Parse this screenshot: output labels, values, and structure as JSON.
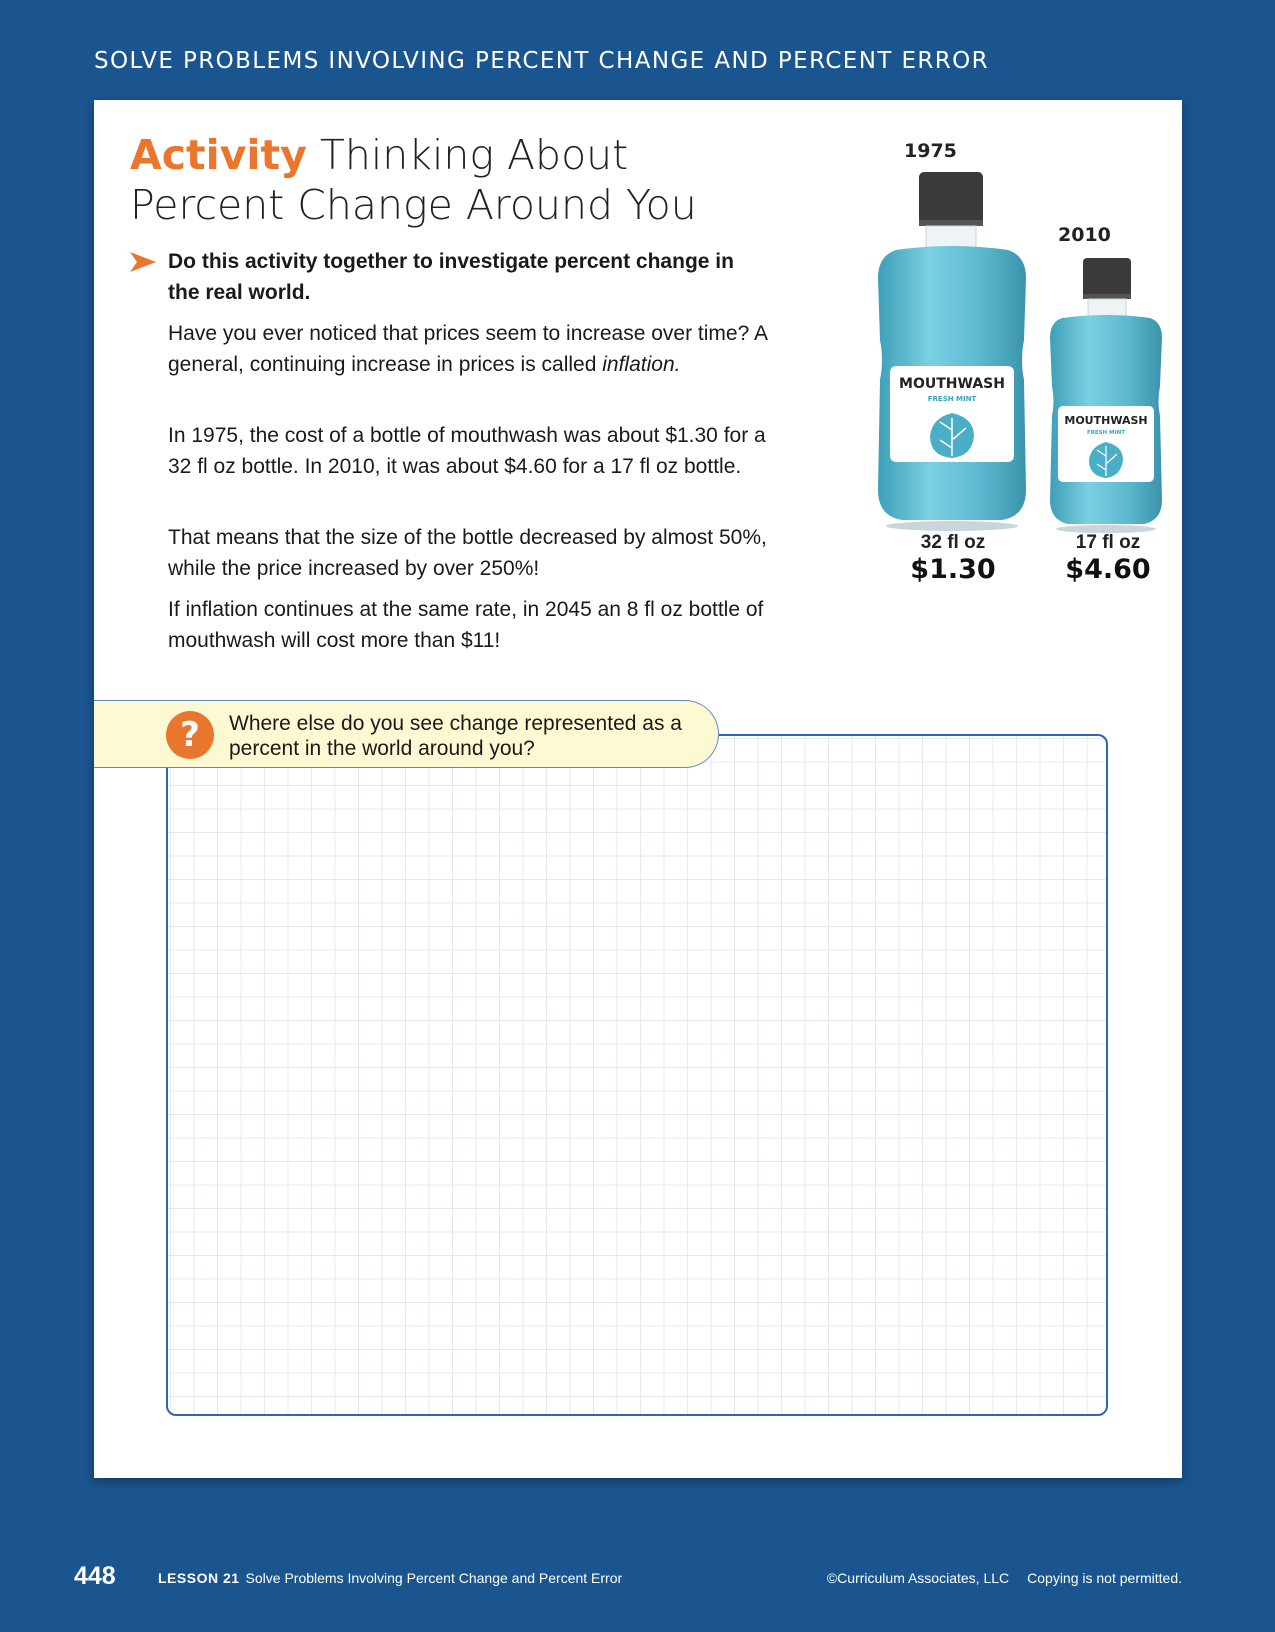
{
  "banner": "SOLVE PROBLEMS INVOLVING PERCENT CHANGE AND PERCENT ERROR",
  "activity": {
    "keyword": "Activity",
    "title": "Thinking About Percent Change Around You",
    "lead": "Do this activity together to investigate percent change in the real world.",
    "p1_before": "Have you ever noticed that prices seem to increase over time? A general, continuing increase in prices is called ",
    "p1_italic": "inflation.",
    "p2": "In 1975, the cost of a bottle of mouthwash was about $1.30 for a 32 fl oz bottle. In 2010, it was about $4.60 for a 17 fl oz bottle.",
    "p3": "That means that the size of the bottle decreased by almost 50%, while the price increased by over 250%!",
    "p4": "If inflation continues at the same rate, in 2045 an 8 fl oz bottle of mouthwash will cost more than $11!"
  },
  "bottles": [
    {
      "year": "1975",
      "label": "MOUTHWASH",
      "sublabel": "FRESH MINT",
      "size": "32 fl oz",
      "price": "$1.30"
    },
    {
      "year": "2010",
      "label": "MOUTHWASH",
      "sublabel": "FRESH MINT",
      "size": "17 fl oz",
      "price": "$4.60"
    }
  ],
  "question": {
    "icon": "question-icon",
    "glyph": "?",
    "text": "Where else do you see change represented as a percent in the world around you?"
  },
  "footer": {
    "page_number": "448",
    "lesson_label": "LESSON 21",
    "lesson_title": "Solve Problems Involving Percent Change and Percent Error",
    "copyright": "©Curriculum Associates, LLC",
    "notice": "Copying is not permitted."
  },
  "colors": {
    "background": "#1a5590",
    "accent_orange": "#e8762c",
    "question_bg": "#fdf9d2",
    "grid_border": "#2f64b6",
    "bottle_teal": "#5cb8cf"
  }
}
